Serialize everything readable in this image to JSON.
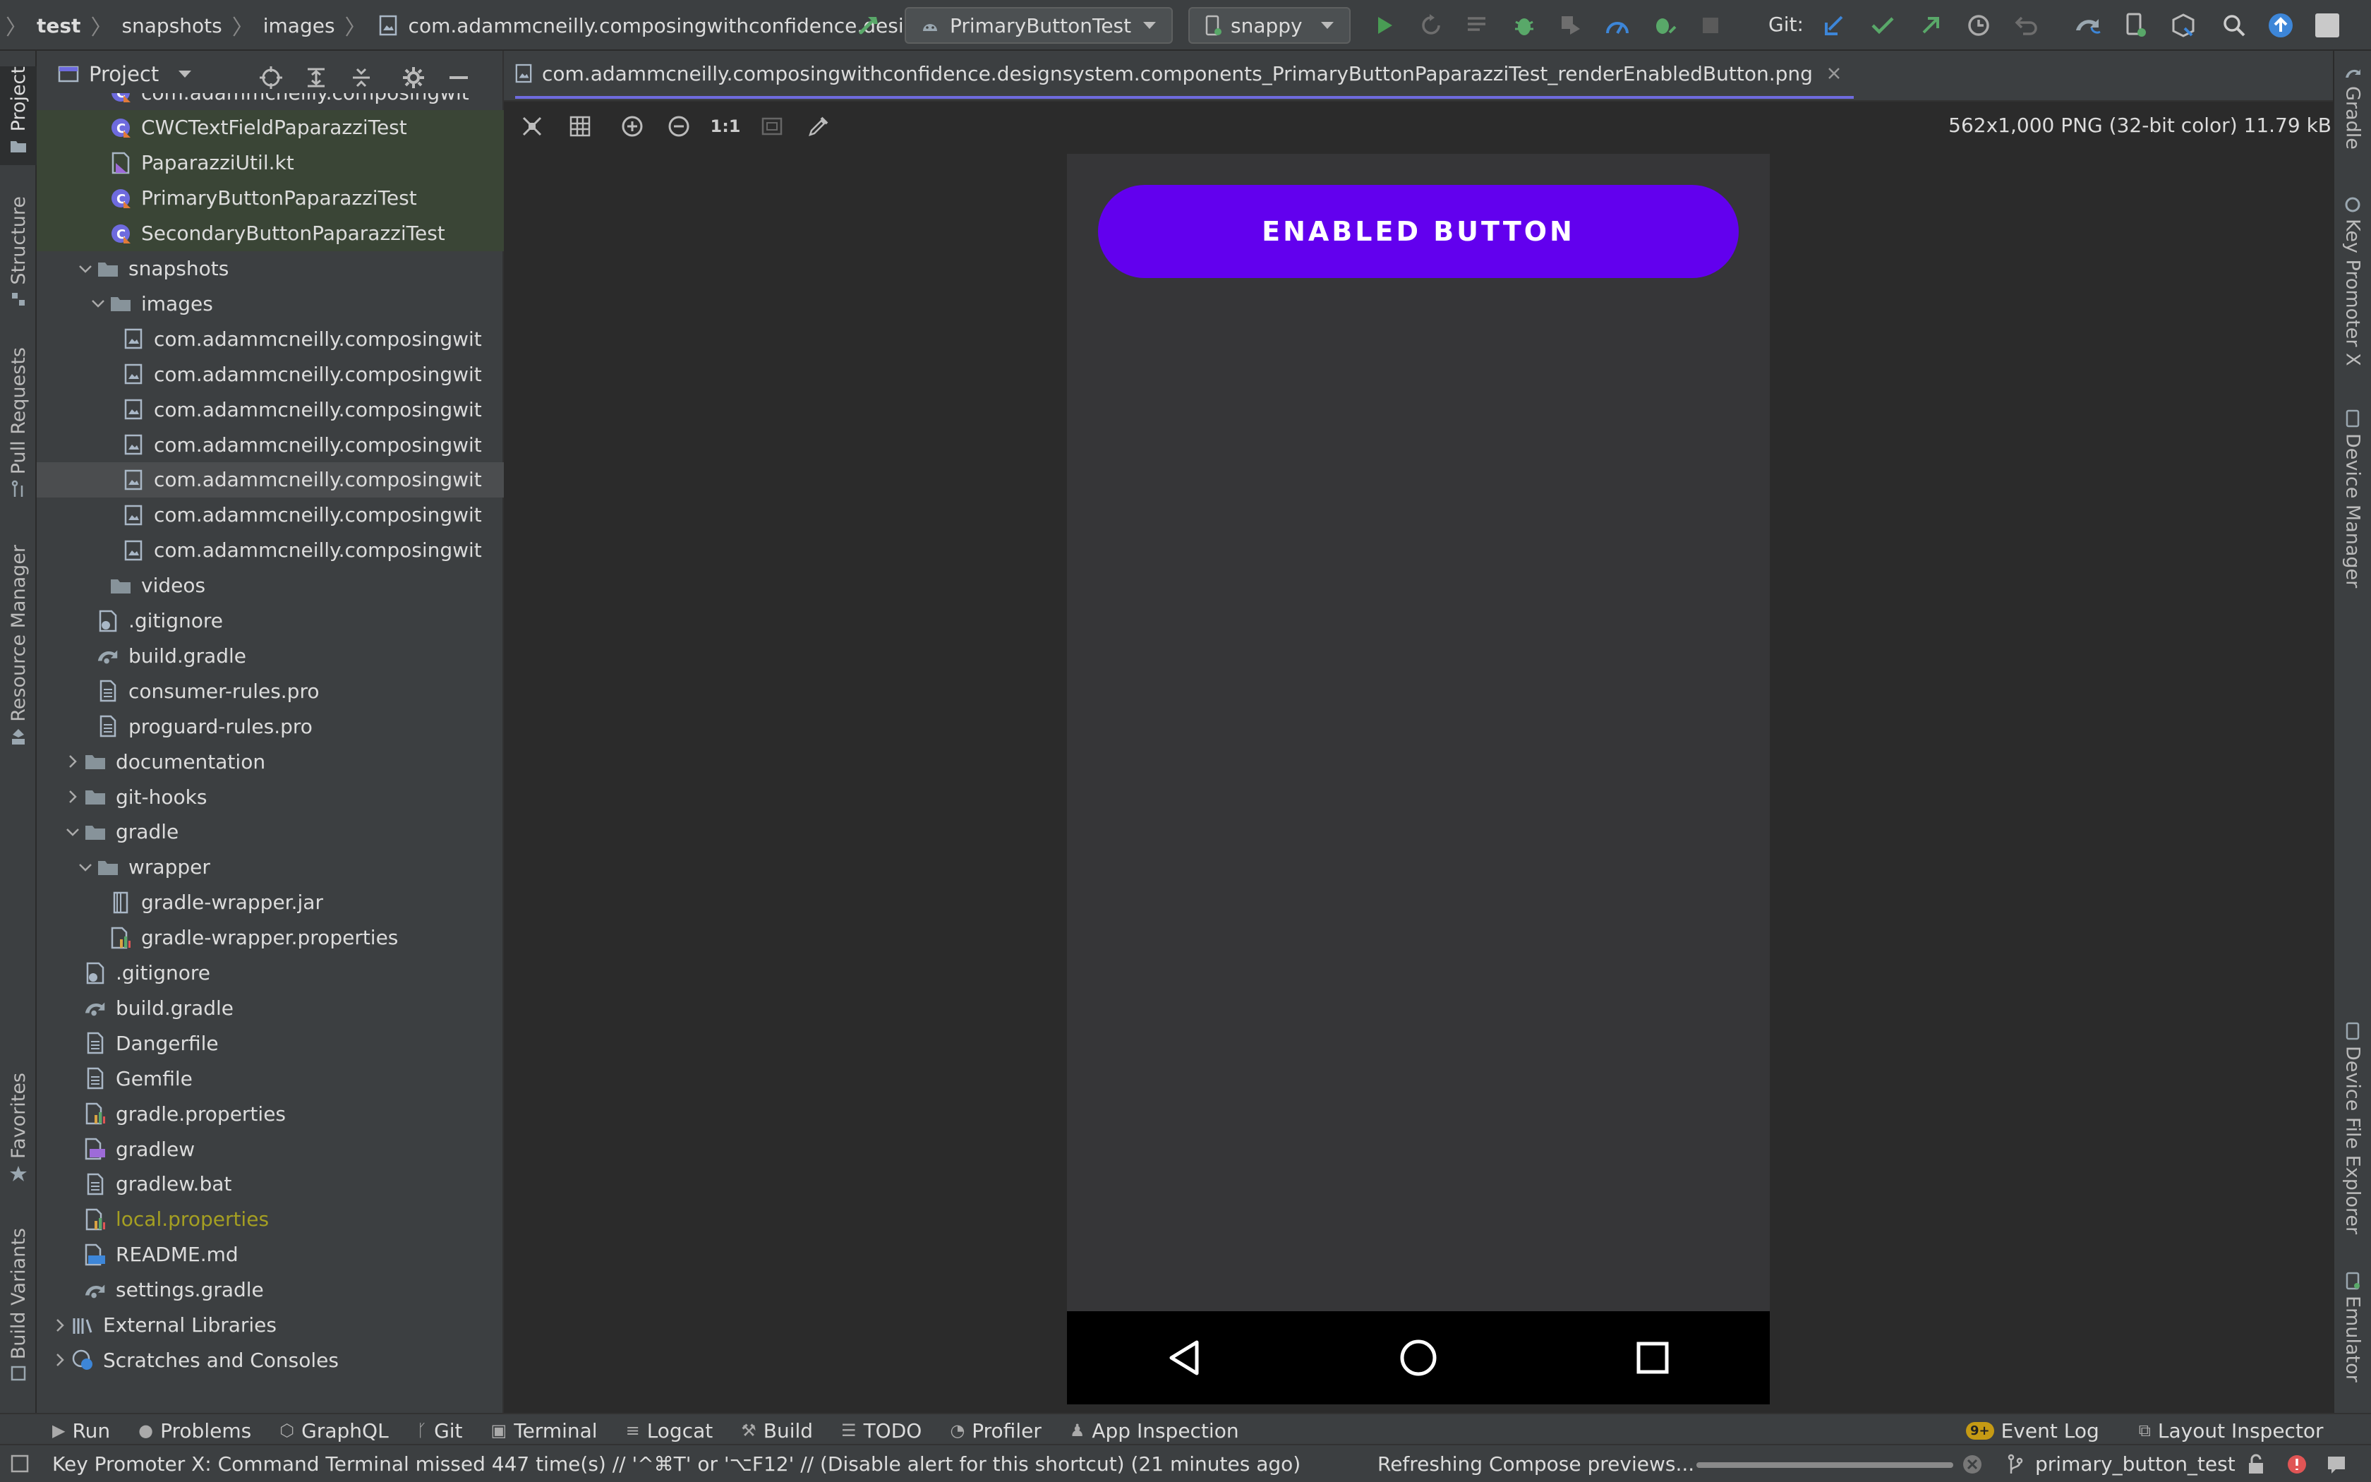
{
  "breadcrumb": [
    "test",
    "snapshots",
    "images",
    "com.adammcneilly.composingwithconfidence.design..."
  ],
  "toolbar": {
    "run_config": "PrimaryButtonTest",
    "device": "snappy",
    "git_label": "Git:"
  },
  "project_panel": {
    "title": "Project",
    "items": [
      {
        "label": "com.adammcneilly.composingwit",
        "indent": 3,
        "icon": "kotlin-class-icon",
        "partial": true
      },
      {
        "label": "CWCTextFieldPaparazziTest",
        "indent": 3,
        "icon": "kotlin-class-icon"
      },
      {
        "label": "PaparazziUtil.kt",
        "indent": 3,
        "icon": "kotlin-file-icon"
      },
      {
        "label": "PrimaryButtonPaparazziTest",
        "indent": 3,
        "icon": "kotlin-class-icon"
      },
      {
        "label": "SecondaryButtonPaparazziTest",
        "indent": 3,
        "icon": "kotlin-class-icon"
      },
      {
        "label": "snapshots",
        "indent": 2,
        "icon": "folder-icon",
        "expanded": true
      },
      {
        "label": "images",
        "indent": 3,
        "icon": "folder-icon",
        "expanded": true
      },
      {
        "label": "com.adammcneilly.composingwit",
        "indent": 4,
        "icon": "image-file-icon"
      },
      {
        "label": "com.adammcneilly.composingwit",
        "indent": 4,
        "icon": "image-file-icon"
      },
      {
        "label": "com.adammcneilly.composingwit",
        "indent": 4,
        "icon": "image-file-icon"
      },
      {
        "label": "com.adammcneilly.composingwit",
        "indent": 4,
        "icon": "image-file-icon"
      },
      {
        "label": "com.adammcneilly.composingwit",
        "indent": 4,
        "icon": "image-file-icon",
        "selected": true
      },
      {
        "label": "com.adammcneilly.composingwit",
        "indent": 4,
        "icon": "image-file-icon"
      },
      {
        "label": "com.adammcneilly.composingwit",
        "indent": 4,
        "icon": "image-file-icon"
      },
      {
        "label": "videos",
        "indent": 3,
        "icon": "folder-icon"
      },
      {
        "label": ".gitignore",
        "indent": 2,
        "icon": "gitignore-file-icon"
      },
      {
        "label": "build.gradle",
        "indent": 2,
        "icon": "gradle-file-icon"
      },
      {
        "label": "consumer-rules.pro",
        "indent": 2,
        "icon": "text-file-icon"
      },
      {
        "label": "proguard-rules.pro",
        "indent": 2,
        "icon": "text-file-icon"
      },
      {
        "label": "documentation",
        "indent": 1,
        "icon": "folder-icon",
        "collapsed": true
      },
      {
        "label": "git-hooks",
        "indent": 1,
        "icon": "folder-icon",
        "collapsed": true
      },
      {
        "label": "gradle",
        "indent": 1,
        "icon": "folder-icon",
        "expanded": true
      },
      {
        "label": "wrapper",
        "indent": 2,
        "icon": "folder-icon",
        "expanded": true
      },
      {
        "label": "gradle-wrapper.jar",
        "indent": 3,
        "icon": "jar-file-icon"
      },
      {
        "label": "gradle-wrapper.properties",
        "indent": 3,
        "icon": "properties-file-icon"
      },
      {
        "label": ".gitignore",
        "indent": 1,
        "icon": "gitignore-file-icon"
      },
      {
        "label": "build.gradle",
        "indent": 1,
        "icon": "gradle-file-icon"
      },
      {
        "label": "Dangerfile",
        "indent": 1,
        "icon": "text-file-icon"
      },
      {
        "label": "Gemfile",
        "indent": 1,
        "icon": "text-file-icon"
      },
      {
        "label": "gradle.properties",
        "indent": 1,
        "icon": "properties-file-icon"
      },
      {
        "label": "gradlew",
        "indent": 1,
        "icon": "shell-file-icon"
      },
      {
        "label": "gradlew.bat",
        "indent": 1,
        "icon": "text-file-icon"
      },
      {
        "label": "local.properties",
        "indent": 1,
        "icon": "properties-file-icon",
        "highlight": "#a59f22"
      },
      {
        "label": "README.md",
        "indent": 1,
        "icon": "markdown-file-icon"
      },
      {
        "label": "settings.gradle",
        "indent": 1,
        "icon": "gradle-file-icon"
      },
      {
        "label": "External Libraries",
        "indent": 0,
        "icon": "library-icon",
        "collapsed": true
      },
      {
        "label": "Scratches and Consoles",
        "indent": 0,
        "icon": "scratches-icon",
        "collapsed": true
      }
    ]
  },
  "left_tool_windows": [
    "Project",
    "Structure",
    "Pull Requests",
    "Resource Manager",
    "Favorites",
    "Build Variants"
  ],
  "right_tool_windows": [
    "Gradle",
    "Key Promoter X",
    "Device Manager",
    "Device File Explorer",
    "Emulator"
  ],
  "editor_tab": {
    "label": "com.adammcneilly.composingwithconfidence.designsystem.components_PrimaryButtonPaparazziTest_renderEnabledButton.png"
  },
  "image_toolbar": {
    "zoom_actual": "1:1",
    "image_info": "562x1,000 PNG (32-bit color) 11.79 kB"
  },
  "preview": {
    "button_label": "ENABLED BUTTON",
    "button_color": "#6200ee",
    "background": "#363638"
  },
  "bottom_tools": [
    "Run",
    "Problems",
    "GraphQL",
    "Git",
    "Terminal",
    "Logcat",
    "Build",
    "TODO",
    "Profiler",
    "App Inspection"
  ],
  "bottom_tools_right": {
    "event_log_badge": "9+",
    "event_log": "Event Log",
    "layout_inspector": "Layout Inspector"
  },
  "status": {
    "message": "Key Promoter X: Command Terminal missed 447 time(s) // '^⌘T' or '⌥F12' // (Disable alert for this shortcut) (21 minutes ago)",
    "progress_text": "Refreshing Compose previews...",
    "branch": "primary_button_test"
  },
  "colors": {
    "accent_purple": "#6200ee",
    "run_green": "#499c54",
    "git_blue": "#3d86d8",
    "git_green": "#59a869",
    "local_properties": "#a59f22"
  }
}
